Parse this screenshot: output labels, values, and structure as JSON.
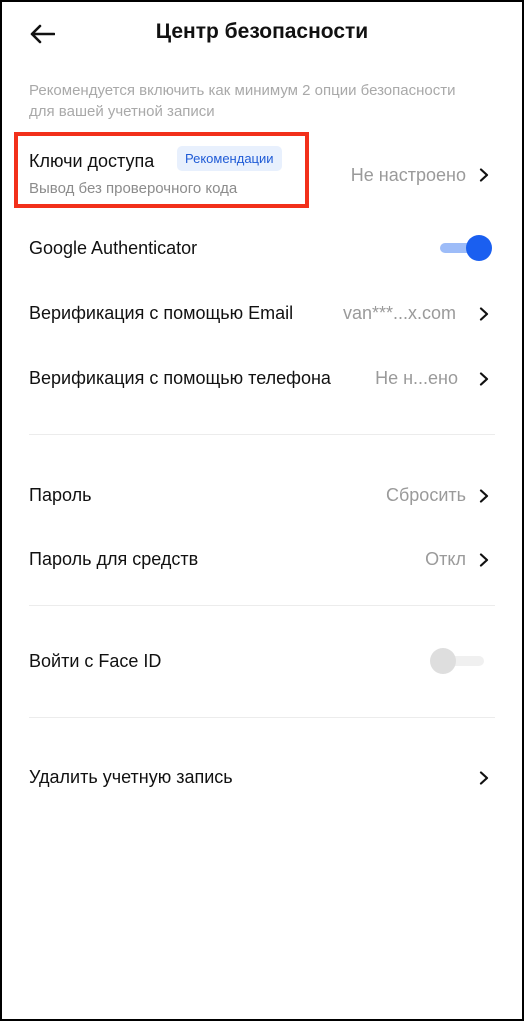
{
  "header": {
    "title": "Центр безопасности"
  },
  "subtitle": "Рекомендуется включить как минимум 2 опции безопасности для вашей учетной записи",
  "passkeys": {
    "label": "Ключи доступа",
    "badge": "Рекомендации",
    "description": "Вывод без проверочного кода",
    "value": "Не настроено"
  },
  "google_auth": {
    "label": "Google Authenticator",
    "enabled": true
  },
  "email_verification": {
    "label": "Верификация с помощью Email",
    "value": "van***...x.com"
  },
  "phone_verification": {
    "label": "Верификация с помощью телефона",
    "value": "Не н...ено"
  },
  "password": {
    "label": "Пароль",
    "value": "Сбросить"
  },
  "fund_password": {
    "label": "Пароль для средств",
    "value": "Откл"
  },
  "face_id": {
    "label": "Войти с Face ID",
    "enabled": false
  },
  "delete_account": {
    "label": "Удалить учетную запись"
  },
  "colors": {
    "accent": "#1a5ff0",
    "highlight_border": "#f2301a",
    "badge_text": "#1f5bd6",
    "badge_bg": "#e8f0fd",
    "secondary_text": "#9a9a9a"
  },
  "icons": {
    "back": "arrow-left-icon",
    "chevron": "chevron-right-icon"
  }
}
